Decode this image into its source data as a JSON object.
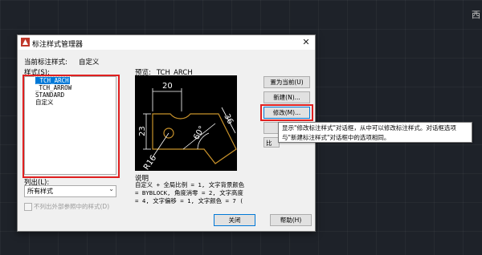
{
  "background": {
    "corner_text": "西"
  },
  "dialog": {
    "title": "标注样式管理器",
    "current_style_label": "当前标注样式:",
    "current_style_value": "自定义",
    "styles_label": "样式(S):",
    "styles": [
      {
        "name": "_TCH_ARCH",
        "selected": true
      },
      {
        "name": "_TCH_ARROW",
        "selected": false
      },
      {
        "name": "STANDARD",
        "selected": false
      },
      {
        "name": "自定义",
        "selected": false
      }
    ],
    "list_label": "列出(L):",
    "list_value": "所有样式",
    "checkbox_label": "不列出外部参照中的样式(D)",
    "preview_label": "预览: _TCH_ARCH",
    "description_label": "说明",
    "description_lines": [
      "自定义 + 全局比例 = 1, 文字背景颜色",
      "= BYBLOCK, 角度消零 = 2, 文字高度",
      "= 4, 文字偏移 = 1, 文字颜色 = 7 ("
    ],
    "buttons": {
      "set_current": "置为当前(U)",
      "new": "新建(N)...",
      "modify": "修改(M)...",
      "compare": "比",
      "close": "关闭",
      "help": "帮助(H)"
    },
    "preview_dims": {
      "top": "20",
      "left": "23",
      "right": "36",
      "angle": "60°",
      "radius": "R16"
    }
  },
  "tooltip": {
    "line1": "显示\"修改标注样式\"对话框，从中可以修改标注样式。对话框选项",
    "line2": "与\"新建标注样式\"对话框中的选项相同。"
  },
  "colors": {
    "highlight": "#e02020",
    "selection": "#0078d7",
    "dim_line": "#ffffff",
    "geometry": "#c8922b"
  }
}
